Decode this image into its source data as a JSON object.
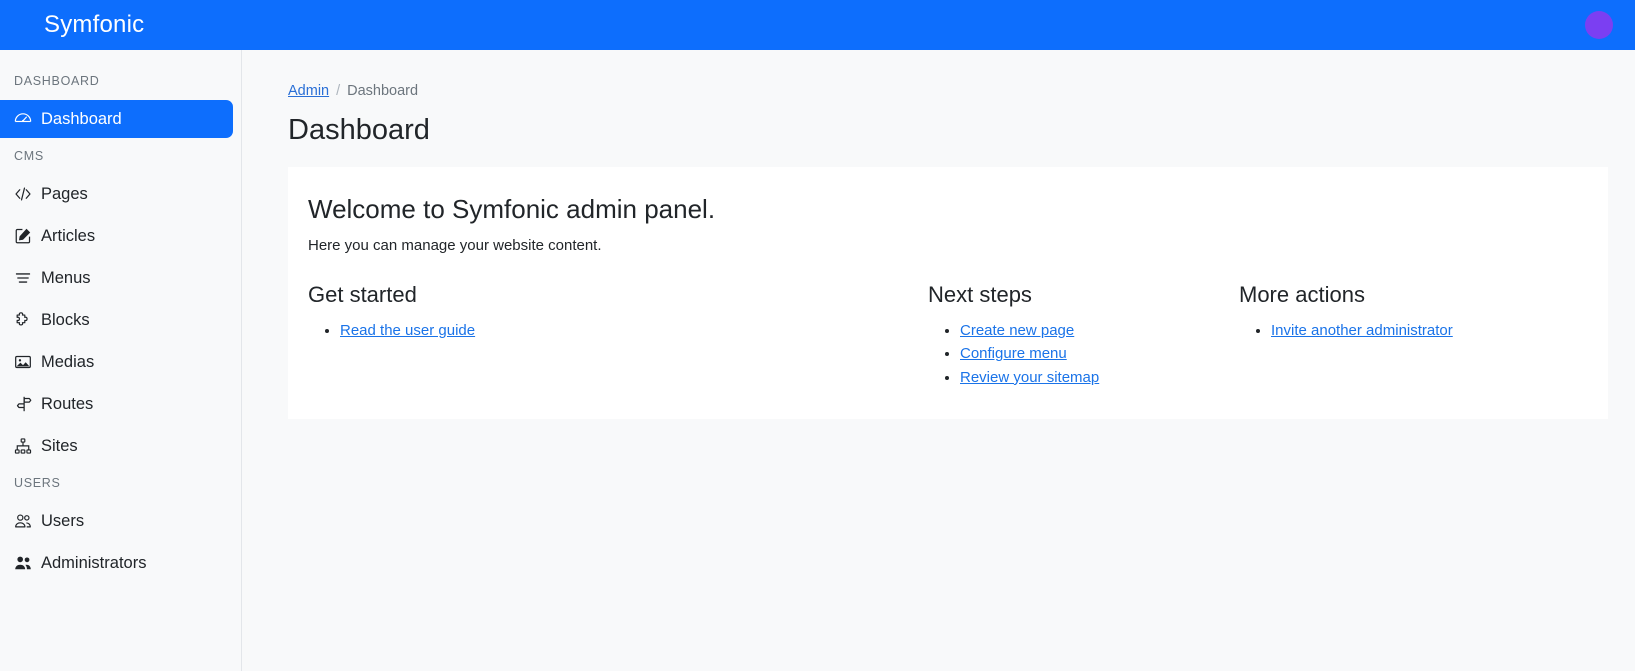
{
  "header": {
    "brand": "Symfonic",
    "avatar_color": "#7b3ff2",
    "bar_color": "#0d6efd"
  },
  "sidebar": {
    "sections": [
      {
        "label": "DASHBOARD",
        "items": [
          {
            "label": "Dashboard",
            "icon": "gauge-icon",
            "active": true
          }
        ]
      },
      {
        "label": "CMS",
        "items": [
          {
            "label": "Pages",
            "icon": "code-icon",
            "active": false
          },
          {
            "label": "Articles",
            "icon": "pencil-square-icon",
            "active": false
          },
          {
            "label": "Menus",
            "icon": "list-lines-icon",
            "active": false
          },
          {
            "label": "Blocks",
            "icon": "puzzle-piece-icon",
            "active": false
          },
          {
            "label": "Medias",
            "icon": "image-icon",
            "active": false
          },
          {
            "label": "Routes",
            "icon": "signpost-icon",
            "active": false
          },
          {
            "label": "Sites",
            "icon": "sitemap-icon",
            "active": false
          }
        ]
      },
      {
        "label": "USERS",
        "items": [
          {
            "label": "Users",
            "icon": "people-outline-icon",
            "active": false
          },
          {
            "label": "Administrators",
            "icon": "people-filled-icon",
            "active": false
          }
        ]
      }
    ]
  },
  "main": {
    "breadcrumb": {
      "link_label": "Admin",
      "separator": "/",
      "current_label": "Dashboard"
    },
    "page_title": "Dashboard",
    "card": {
      "title": "Welcome to Symfonic admin panel.",
      "subtitle": "Here you can manage your website content.",
      "columns": [
        {
          "heading": "Get started",
          "links": [
            "Read the user guide"
          ]
        },
        {
          "heading": "Next steps",
          "links": [
            "Create new page",
            "Configure menu",
            "Review your sitemap"
          ]
        },
        {
          "heading": "More actions",
          "links": [
            "Invite another administrator"
          ]
        }
      ]
    }
  }
}
